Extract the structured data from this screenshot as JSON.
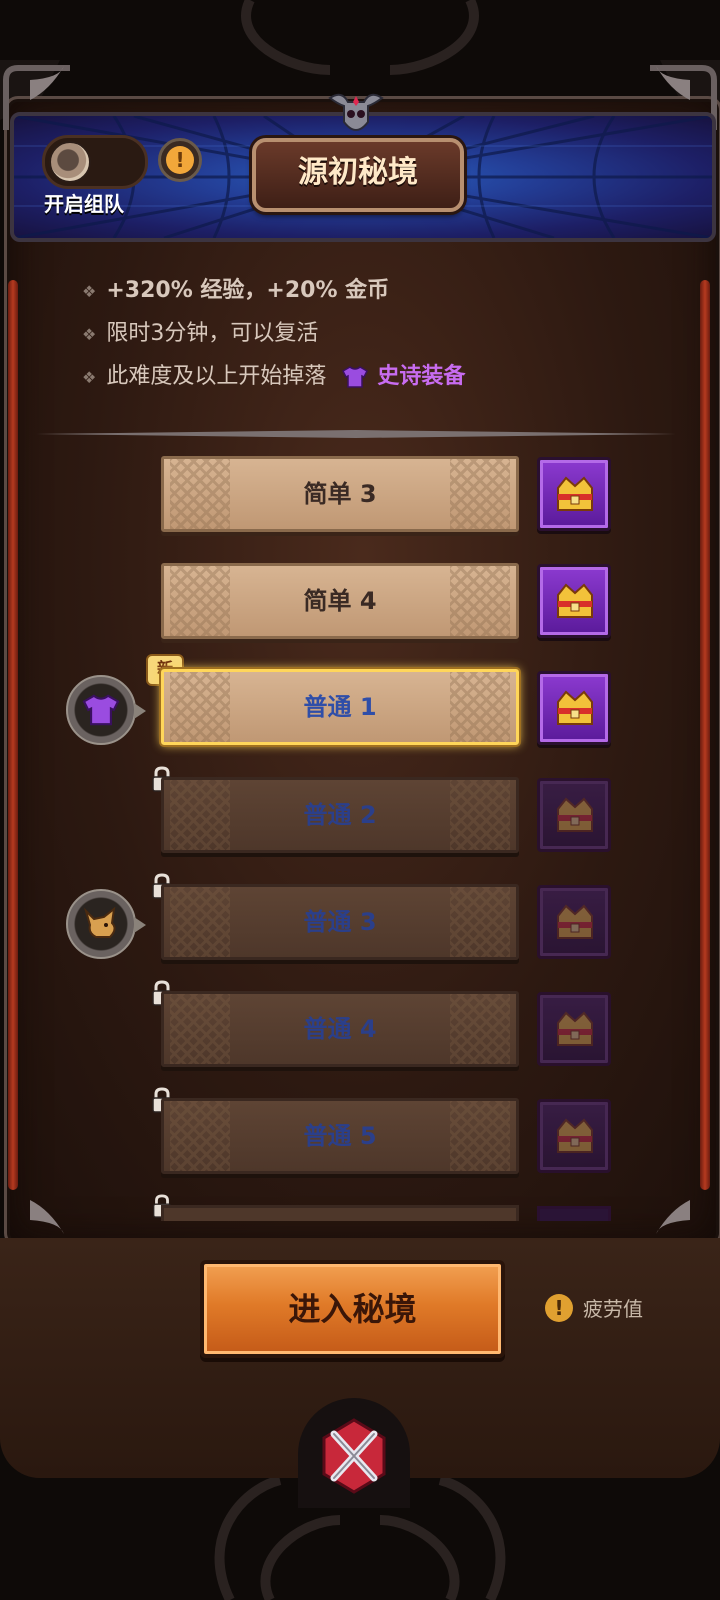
{
  "header": {
    "team_toggle_label": "开启组队",
    "info_symbol": "!",
    "title": "源初秘境"
  },
  "info": {
    "line1": "+320% 经验，+20% 金币",
    "line2": "限时3分钟，可以复活",
    "line3_prefix": "此难度及以上开始掉落",
    "line3_item": "史诗装备",
    "bullet": "❖"
  },
  "levels": [
    {
      "label": "简单 3",
      "state": "unlocked"
    },
    {
      "label": "简单 4",
      "state": "unlocked"
    },
    {
      "label": "普通 1",
      "state": "selected",
      "tag": "新"
    },
    {
      "label": "普通 2",
      "state": "locked"
    },
    {
      "label": "普通 3",
      "state": "locked"
    },
    {
      "label": "普通 4",
      "state": "locked"
    },
    {
      "label": "普通 5",
      "state": "locked"
    }
  ],
  "reward_icons": [
    "epic-armor-icon",
    "wolf-pet-icon"
  ],
  "footer": {
    "enter_button": "进入秘境",
    "fatigue_symbol": "!",
    "fatigue_label": "疲劳值"
  },
  "colors": {
    "accent_orange": "#e07a28",
    "epic_purple": "#c86cf0",
    "normal_blue": "#2f4ea8",
    "selected_gold": "#ffd65a"
  }
}
